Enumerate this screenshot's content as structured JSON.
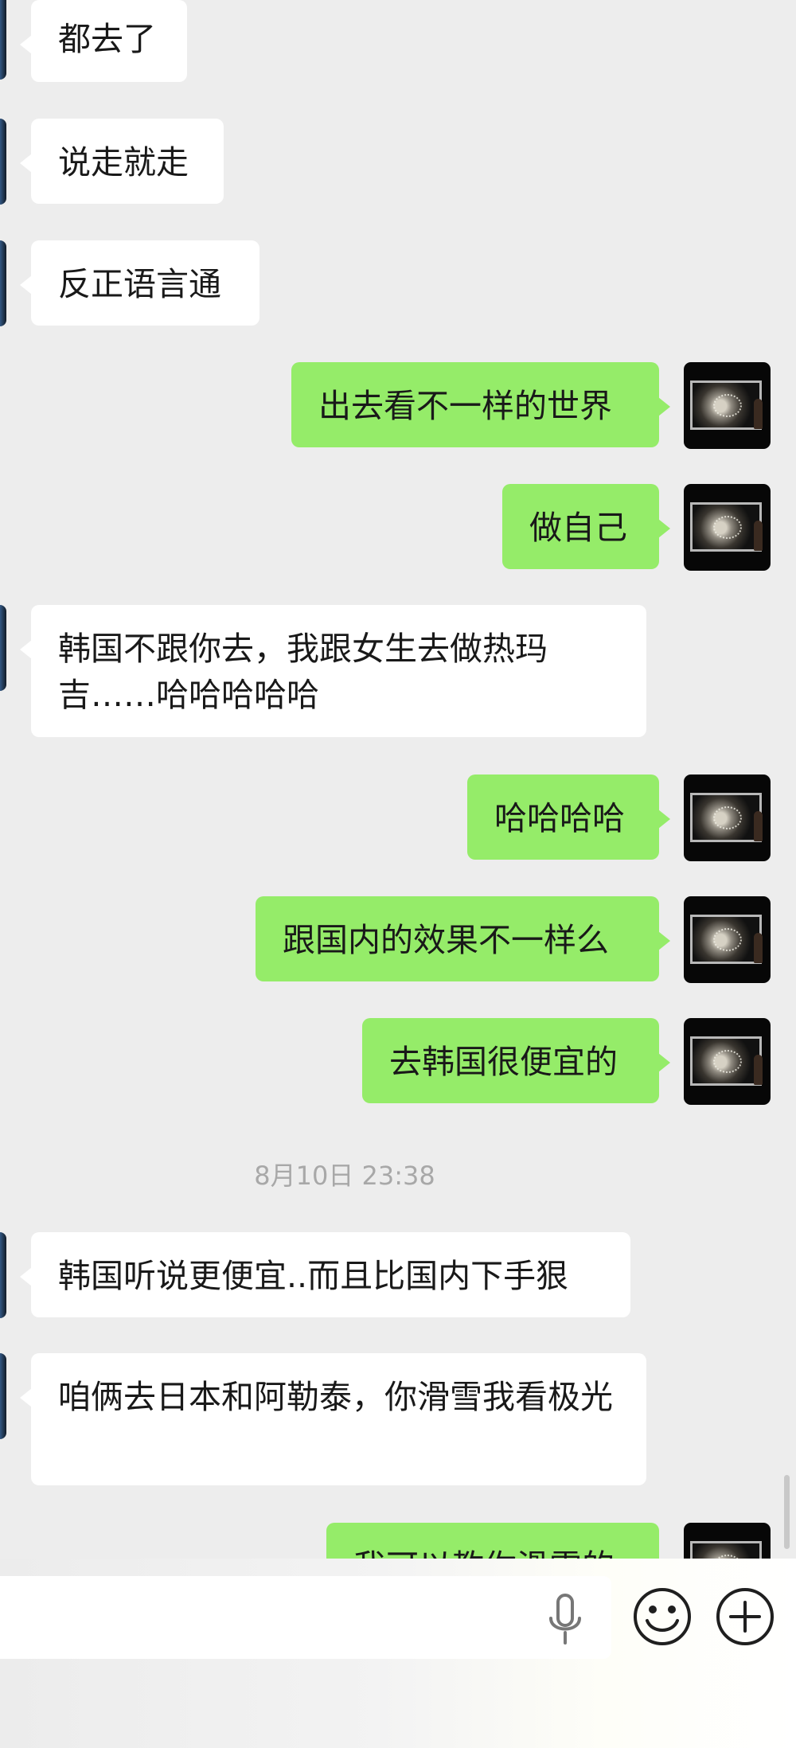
{
  "chat": {
    "messages": [
      {
        "id": "m1",
        "side": "in",
        "text": "都去了"
      },
      {
        "id": "m2",
        "side": "in",
        "text": "说走就走"
      },
      {
        "id": "m3",
        "side": "in",
        "text": "反正语言通"
      },
      {
        "id": "m4",
        "side": "out",
        "text": "出去看不一样的世界"
      },
      {
        "id": "m5",
        "side": "out",
        "text": "做自己"
      },
      {
        "id": "m6",
        "side": "in",
        "text": "韩国不跟你去，我跟女生去做热玛吉……哈哈哈哈哈"
      },
      {
        "id": "m7",
        "side": "out",
        "text": "哈哈哈哈"
      },
      {
        "id": "m8",
        "side": "out",
        "text": "跟国内的效果不一样么"
      },
      {
        "id": "m9",
        "side": "out",
        "text": "去韩国很便宜的"
      },
      {
        "id": "m10",
        "side": "in",
        "text": "韩国听说更便宜..而且比国内下手狠"
      },
      {
        "id": "m11",
        "side": "in",
        "text": "咱俩去日本和阿勒泰，你滑雪我看极光"
      },
      {
        "id": "m12",
        "side": "out",
        "text": "我可以教你滑雪的"
      }
    ],
    "timestamp": "8月10日 23:38"
  },
  "composer": {
    "input_value": "",
    "icons": [
      "microphone-icon",
      "emoji-icon",
      "plus-icon"
    ]
  },
  "colors": {
    "background": "#ededed",
    "incoming_bubble": "#ffffff",
    "outgoing_bubble": "#95ec69",
    "text": "#191919",
    "timestamp": "#a8a8a8"
  }
}
